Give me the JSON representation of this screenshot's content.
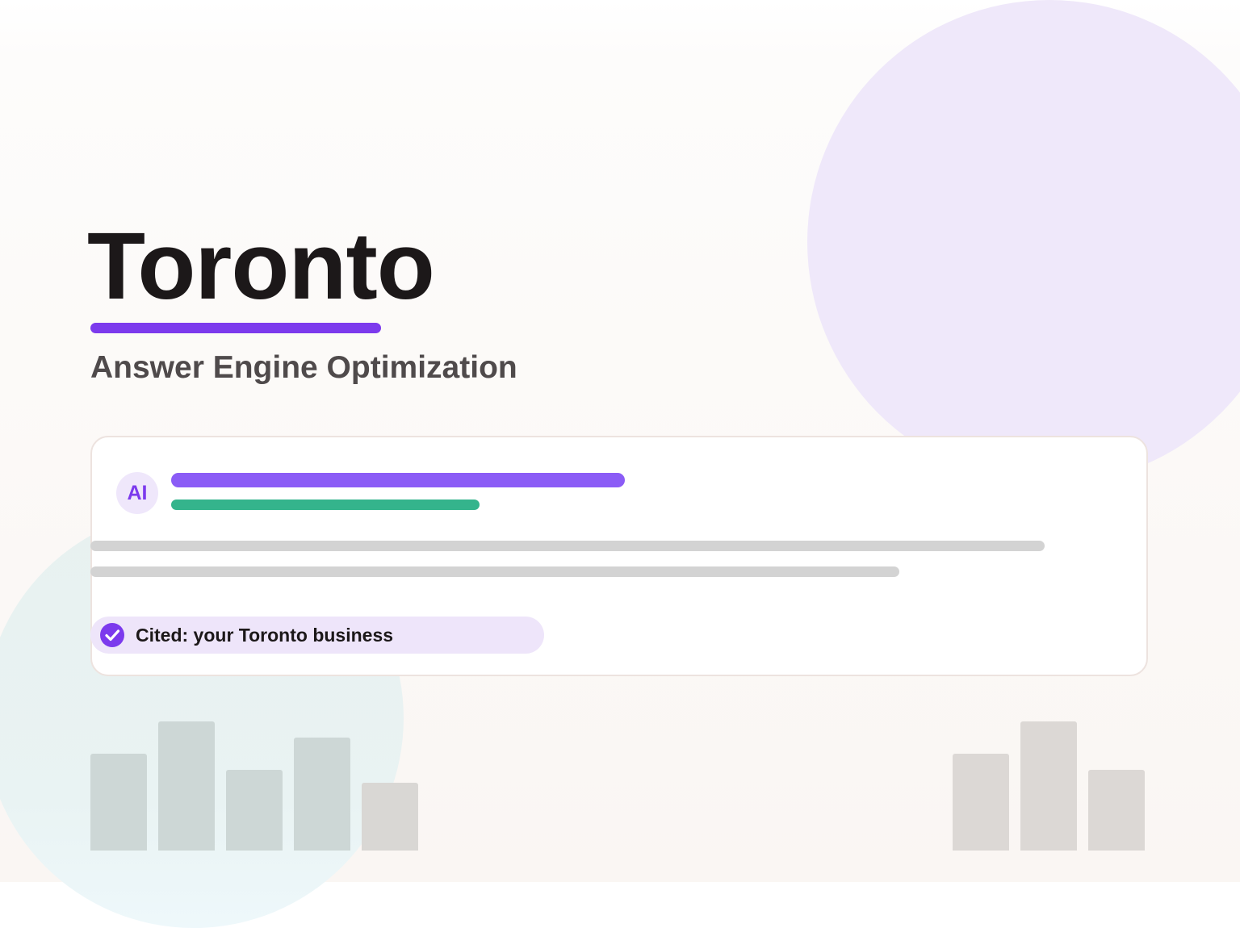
{
  "hero": {
    "title": "Toronto",
    "subtitle": "Answer Engine Optimization"
  },
  "answer_card": {
    "avatar_label": "AI",
    "citation_label": "Cited: your Toronto business",
    "citation_icon": "check-circle-icon"
  },
  "colors": {
    "accent_purple": "#7c3aed",
    "bar_purple": "#8b5cf6",
    "bar_green": "#34b48c",
    "placeholder_gray": "#d3d3d3",
    "pill_background": "#eee5fa",
    "circle_purple": "#efe8fa",
    "circle_teal": "#e8f1f0"
  }
}
